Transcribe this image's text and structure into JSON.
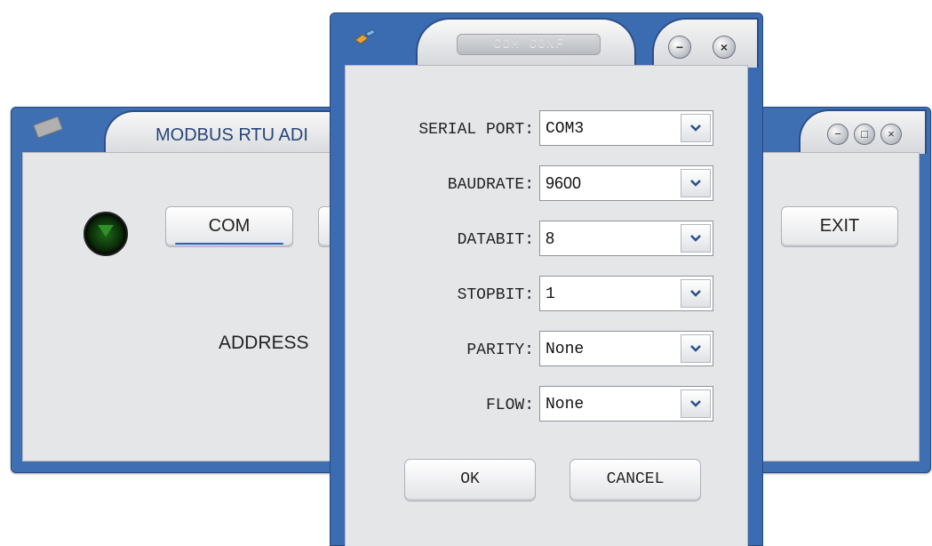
{
  "main_window": {
    "title": "MODBUS RTU ADI",
    "com_button": "COM",
    "exit_button": "EXIT",
    "address_label": "ADDRESS",
    "controls": [
      "−",
      "□",
      "×"
    ]
  },
  "dialog": {
    "title": "COM CONF",
    "min_glyph": "−",
    "close_glyph": "×",
    "fields": [
      {
        "label": "SERIAL PORT:",
        "value": "COM3"
      },
      {
        "label": "BAUDRATE:",
        "value": "9600"
      },
      {
        "label": "DATABIT:",
        "value": "8"
      },
      {
        "label": "STOPBIT:",
        "value": "1"
      },
      {
        "label": "PARITY:",
        "value": "None"
      },
      {
        "label": "FLOW:",
        "value": "None"
      }
    ],
    "ok_button": "OK",
    "cancel_button": "CANCEL"
  },
  "colors": {
    "frame_blue": "#3b6cb2",
    "body_gray": "#e5e6e8"
  }
}
